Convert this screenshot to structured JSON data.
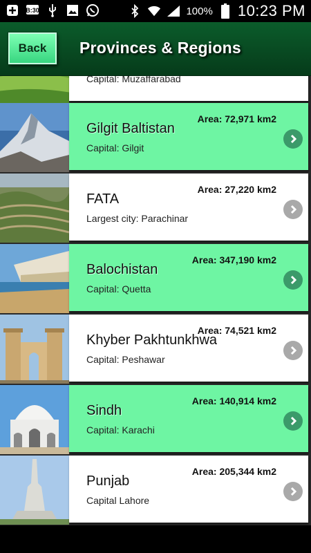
{
  "status_bar": {
    "battery_pct": "100%",
    "time": "10:23 PM",
    "icons": [
      "plus-box-icon",
      "bbm-icon",
      "usb-icon",
      "image-icon",
      "whatsapp-icon",
      "bluetooth-icon",
      "wifi-icon",
      "signal-icon",
      "battery-icon"
    ]
  },
  "header": {
    "back_label": "Back",
    "title": "Provinces & Regions"
  },
  "regions": [
    {
      "name": "",
      "area": "",
      "subtitle": "Capital: Muzaffarabad",
      "style": "white"
    },
    {
      "name": "Gilgit Baltistan",
      "area": "Area: 72,971 km2",
      "subtitle": "Capital: Gilgit",
      "style": "green"
    },
    {
      "name": "FATA",
      "area": "Area: 27,220 km2",
      "subtitle": "Largest city: Parachinar",
      "style": "white"
    },
    {
      "name": "Balochistan",
      "area": "Area: 347,190 km2",
      "subtitle": "Capital: Quetta",
      "style": "green"
    },
    {
      "name": "Khyber Pakhtunkhwa",
      "area": "Area: 74,521 km2",
      "subtitle": "Capital: Peshawar",
      "style": "white"
    },
    {
      "name": "Sindh",
      "area": "Area: 140,914 km2",
      "subtitle": "Capital: Karachi",
      "style": "green"
    },
    {
      "name": "Punjab",
      "area": "Area: 205,344 km2",
      "subtitle": "Capital Lahore",
      "style": "white"
    }
  ]
}
